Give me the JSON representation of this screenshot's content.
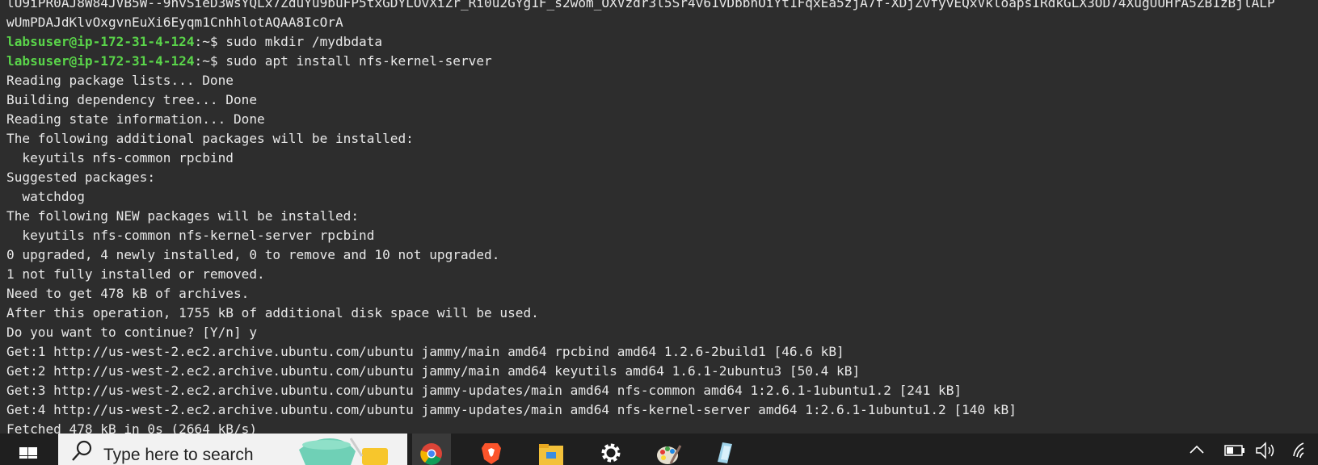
{
  "terminal": {
    "lines": [
      {
        "type": "text",
        "text": "lU9iPR0AJ8W84JVB5W--9hvSieD3WsYQLx7ZduYu9buFP5txGDYLOvXiZr_Ri0u2GYg1F_s2wom_OXVzdr3l5Sr4v61vDbbhOiYt1FqxEa5zjA7f-XDjZvfyvEQxVkloapsIRdkGLX3OD74XugUUHrA5ZB1zBjlALP"
      },
      {
        "type": "text",
        "text": "wUmPDAJdKlvOxgvnEuXi6Eyqm1CnhhlotAQAA8IcOrA"
      },
      {
        "type": "prompt",
        "user": "labsuser@ip-172-31-4-124",
        "sep": ":~$",
        "cmd": " sudo mkdir /mydbdata"
      },
      {
        "type": "prompt",
        "user": "labsuser@ip-172-31-4-124",
        "sep": ":~$",
        "cmd": " sudo apt install nfs-kernel-server"
      },
      {
        "type": "text",
        "text": "Reading package lists... Done"
      },
      {
        "type": "text",
        "text": "Building dependency tree... Done"
      },
      {
        "type": "text",
        "text": "Reading state information... Done"
      },
      {
        "type": "text",
        "text": "The following additional packages will be installed:"
      },
      {
        "type": "text",
        "text": "  keyutils nfs-common rpcbind"
      },
      {
        "type": "text",
        "text": "Suggested packages:"
      },
      {
        "type": "text",
        "text": "  watchdog"
      },
      {
        "type": "text",
        "text": "The following NEW packages will be installed:"
      },
      {
        "type": "text",
        "text": "  keyutils nfs-common nfs-kernel-server rpcbind"
      },
      {
        "type": "text",
        "text": "0 upgraded, 4 newly installed, 0 to remove and 10 not upgraded."
      },
      {
        "type": "text",
        "text": "1 not fully installed or removed."
      },
      {
        "type": "text",
        "text": "Need to get 478 kB of archives."
      },
      {
        "type": "text",
        "text": "After this operation, 1755 kB of additional disk space will be used."
      },
      {
        "type": "text",
        "text": "Do you want to continue? [Y/n] y"
      },
      {
        "type": "text",
        "text": "Get:1 http://us-west-2.ec2.archive.ubuntu.com/ubuntu jammy/main amd64 rpcbind amd64 1.2.6-2build1 [46.6 kB]"
      },
      {
        "type": "text",
        "text": "Get:2 http://us-west-2.ec2.archive.ubuntu.com/ubuntu jammy/main amd64 keyutils amd64 1.6.1-2ubuntu3 [50.4 kB]"
      },
      {
        "type": "text",
        "text": "Get:3 http://us-west-2.ec2.archive.ubuntu.com/ubuntu jammy-updates/main amd64 nfs-common amd64 1:2.6.1-1ubuntu1.2 [241 kB]"
      },
      {
        "type": "text",
        "text": "Get:4 http://us-west-2.ec2.archive.ubuntu.com/ubuntu jammy-updates/main amd64 nfs-kernel-server amd64 1:2.6.1-1ubuntu1.2 [140 kB]"
      },
      {
        "type": "text",
        "text": "Fetched 478 kB in 0s (2664 kB/s)"
      }
    ]
  },
  "taskbar": {
    "search_placeholder": "Type here to search",
    "apps": [
      "chrome-icon",
      "brave-icon",
      "file-explorer-icon",
      "settings-gear-icon",
      "paint-icon",
      "notepad-icon"
    ],
    "tray": [
      "chevron-up-icon",
      "battery-icon",
      "volume-icon",
      "wifi-icon"
    ]
  },
  "colors": {
    "terminal_bg": "#2d2d2d",
    "terminal_fg": "#e8e8e8",
    "prompt_user": "#5ad54a",
    "taskbar_bg": "#1f1f1f",
    "search_bg": "#f2f2f2"
  }
}
